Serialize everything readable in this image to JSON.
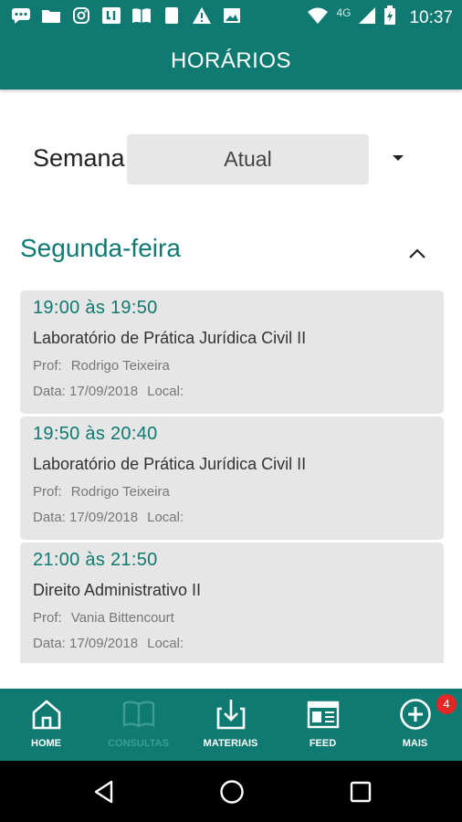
{
  "status_bar": {
    "time": "10:37",
    "network": "4G",
    "left_icons": [
      "message-icon",
      "folder-icon",
      "instagram-icon",
      "app-box-icon",
      "book-open-icon",
      "phone-card-icon",
      "warning-icon",
      "image-icon"
    ],
    "right_icons": [
      "wifi-icon",
      "signal-icon",
      "battery-icon"
    ]
  },
  "app_bar": {
    "title": "HORÁRIOS"
  },
  "week": {
    "label": "Semana",
    "selected": "Atual"
  },
  "day": {
    "title": "Segunda-feira",
    "expanded": true
  },
  "classes": [
    {
      "time": "19:00 às  19:50",
      "subject": "Laboratório de Prática Jurídica Civil II",
      "prof_label": "Prof:",
      "prof": "Rodrigo Teixeira",
      "data_label": "Data:",
      "date": "17/09/2018",
      "local_label": "Local:",
      "local": ""
    },
    {
      "time": "19:50 às  20:40",
      "subject": "Laboratório de Prática Jurídica Civil II",
      "prof_label": "Prof:",
      "prof": "Rodrigo Teixeira",
      "data_label": "Data:",
      "date": "17/09/2018",
      "local_label": "Local:",
      "local": ""
    },
    {
      "time": "21:00 às  21:50",
      "subject": "Direito Administrativo II",
      "prof_label": "Prof:",
      "prof": "Vania Bittencourt",
      "data_label": "Data:",
      "date": "17/09/2018",
      "local_label": "Local:",
      "local": ""
    }
  ],
  "bottom_nav": {
    "items": [
      {
        "label": "HOME",
        "icon": "home-icon"
      },
      {
        "label": "CONSULTAS",
        "icon": "book-icon",
        "disabled": true
      },
      {
        "label": "MATERIAIS",
        "icon": "download-icon"
      },
      {
        "label": "FEED",
        "icon": "newspaper-icon"
      },
      {
        "label": "MAIS",
        "icon": "plus-circle-icon",
        "badge": "4"
      }
    ]
  },
  "colors": {
    "primary": "#0e7a71",
    "card": "#e6e6e6",
    "badge": "#e52727"
  }
}
